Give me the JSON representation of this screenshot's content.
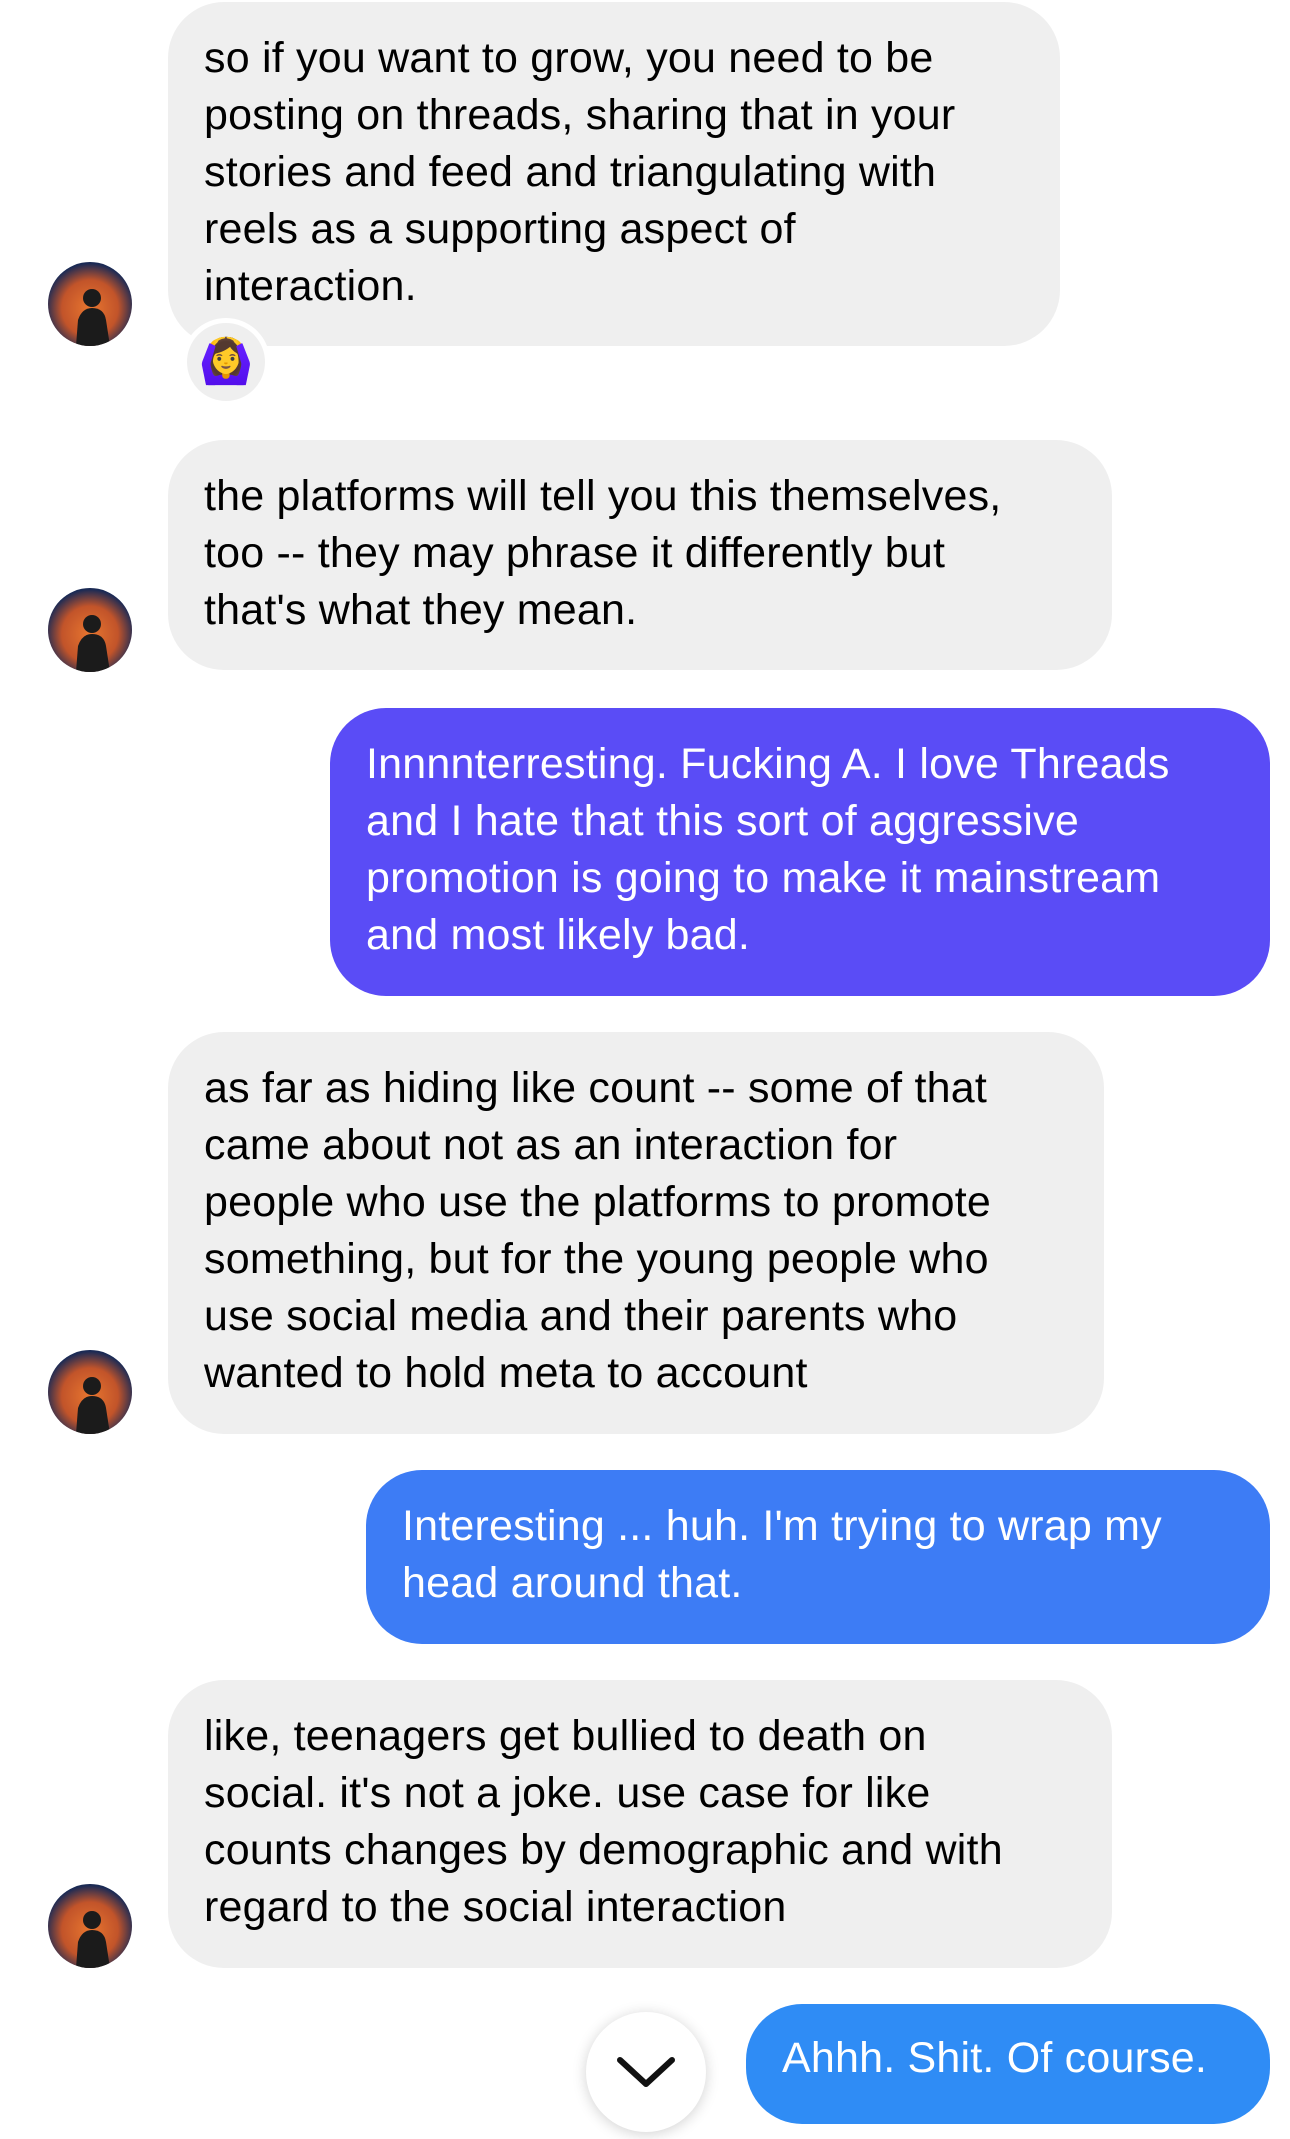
{
  "colors": {
    "incoming_bubble": "#efefef",
    "outgoing_purple": "#5a4cf6",
    "outgoing_blue": "#3d7cf5",
    "outgoing_light_blue": "#2f8cf5"
  },
  "messages": [
    {
      "sender": "them",
      "text": "so if you want to grow, you need to be\nposting on threads, sharing that in your\nstories and feed and triangulating with\nreels as a supporting aspect of\ninteraction.",
      "reaction": "🙆‍♀️"
    },
    {
      "sender": "them",
      "text": "the platforms will tell you this themselves,\ntoo -- they may phrase it differently but\nthat's what they mean."
    },
    {
      "sender": "me",
      "text": "Innnnterresting. Fucking A. I love Threads\nand I hate that this sort of aggressive\npromotion is going to make it mainstream\nand most likely bad."
    },
    {
      "sender": "them",
      "text": "as far as hiding like count -- some of that\ncame about not as an interaction for\npeople who use the platforms to promote\nsomething, but for the young people who\nuse social media and their parents who\nwanted to hold meta to account"
    },
    {
      "sender": "me",
      "text": "Interesting ... huh. I'm trying to wrap my\nhead around that."
    },
    {
      "sender": "them",
      "text": "like, teenagers get bullied to death on\nsocial. it's not a joke. use case for like\ncounts changes by demographic and with\nregard to the social interaction"
    },
    {
      "sender": "me",
      "text": "Ahhh. Shit. Of course."
    }
  ],
  "scroll_button_icon": "chevron-down-icon"
}
